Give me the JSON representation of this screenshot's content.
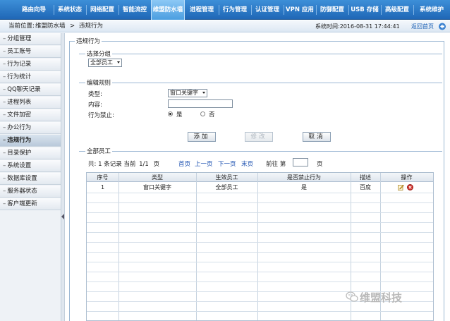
{
  "topnav": {
    "items": [
      {
        "label": "路由向导"
      },
      {
        "label": "系统状态"
      },
      {
        "label": "网络配置"
      },
      {
        "label": "智能流控"
      },
      {
        "label": "维盟防水墙",
        "active": true
      },
      {
        "label": "进程管理"
      },
      {
        "label": "行为管理"
      },
      {
        "label": "认证管理"
      },
      {
        "label": "VPN 应用"
      },
      {
        "label": "防御配置"
      },
      {
        "label": "USB 存储"
      },
      {
        "label": "高级配置"
      },
      {
        "label": "系统维护"
      }
    ]
  },
  "breadcrumb": {
    "prefix": "当前位置:",
    "parent": "维盟防水墙",
    "separator": ">",
    "current": "违规行为"
  },
  "systime": {
    "label": "系统时间:",
    "value": "2016-08-31 17:44:41"
  },
  "home_link": "返回首页",
  "sidebar": {
    "items": [
      {
        "label": "分组管理"
      },
      {
        "label": "员工账号"
      },
      {
        "label": "行为记录"
      },
      {
        "label": "行为统计"
      },
      {
        "label": "QQ聊天记录"
      },
      {
        "label": "进程列表"
      },
      {
        "label": "文件加密"
      },
      {
        "label": "办公行为"
      },
      {
        "label": "违规行为",
        "active": true
      },
      {
        "label": "目录保护"
      },
      {
        "label": "系统设置"
      },
      {
        "label": "数据库设置"
      },
      {
        "label": "服务器状态"
      },
      {
        "label": "客户端更新"
      }
    ],
    "dash": "–"
  },
  "main": {
    "panel_title": "违规行为",
    "group_section": {
      "legend": "选择分组",
      "selected": "全部员工"
    },
    "edit_section": {
      "legend": "编辑规则",
      "type_label": "类型:",
      "type_value": "窗口关键字",
      "content_label": "内容:",
      "content_value": "",
      "forbid_label": "行为禁止:",
      "yes_label": "是",
      "no_label": "否",
      "selected": "是"
    },
    "buttons": {
      "add": "添加",
      "edit": "修改",
      "cancel": "取消"
    },
    "list_section": {
      "legend": "全部员工"
    },
    "pager": {
      "total_prefix": "共:",
      "total": "1",
      "total_suffix": "条记录",
      "current_prefix": "当前",
      "current": "1/1",
      "page_suffix": "页",
      "first": "首页",
      "prev": "上一页",
      "next": "下一页",
      "last": "末页",
      "goto_prefix": "前往 第",
      "goto_value": "",
      "goto_suffix": "页"
    },
    "table": {
      "headers": [
        "序号",
        "类型",
        "生效员工",
        "是否禁止行为",
        "描述",
        "操作"
      ],
      "rows": [
        {
          "no": "1",
          "type": "窗口关键字",
          "staff": "全部员工",
          "forbid": "是",
          "desc": "百度"
        }
      ]
    }
  },
  "watermark": "维盟科技",
  "colors": {
    "nav_blue": "#1f67b6",
    "active_tab": "#8cc8f5",
    "link": "#1a4fb0",
    "delete_red": "#d3312b"
  }
}
